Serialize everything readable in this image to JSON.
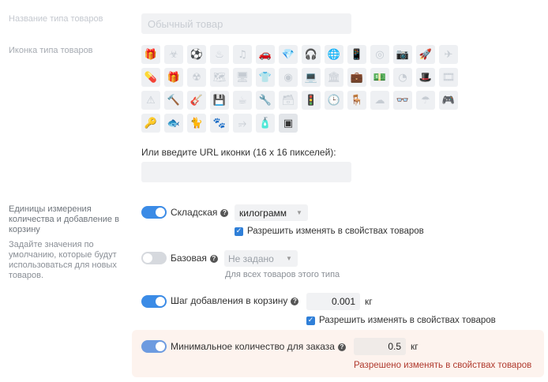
{
  "type_name": {
    "label": "Название типа товаров",
    "value": "Обычный товар"
  },
  "icon_section": {
    "label": "Иконка типа товаров",
    "rows": [
      [
        "gift-icon",
        "virus-icon",
        "soccer-ball-icon",
        "cake-icon",
        "music-note-icon",
        "car-icon",
        "diamond-icon",
        "headphones-icon",
        "globe-icon",
        "phone-icon",
        "target-icon",
        "camera-icon",
        "rocket-icon",
        "paper-plane-icon"
      ],
      [
        "pill-icon",
        "present-box-icon",
        "radiation-icon",
        "map-icon",
        "monitor-icon",
        "tshirt-icon",
        "tire-icon",
        "laptop-icon",
        "bank-icon",
        "briefcase-icon",
        "cash-icon",
        "pie-chart-icon",
        "top-hat-icon",
        "film-icon"
      ],
      [
        "warning-icon",
        "hammer-icon",
        "guitar-icon",
        "floppy-disk-icon",
        "coffee-cup-icon",
        "screwdriver-icon",
        "archive-box-icon",
        "traffic-light-icon",
        "clock-icon",
        "chair-icon",
        "cloud-download-icon",
        "glasses-icon",
        "umbrella-icon",
        "gamepad-icon"
      ],
      [
        "wrench-icon",
        "fish-icon",
        "cat-icon",
        "paw-icon",
        "usb-icon",
        "spray-bottle-icon",
        "package-box-icon"
      ]
    ],
    "glyphs": [
      [
        "🎁",
        "☣",
        "⚽",
        "♨",
        "♫",
        "🚗",
        "💎",
        "🎧",
        "🌐",
        "📱",
        "◎",
        "📷",
        "🚀",
        "✈"
      ],
      [
        "💊",
        "🎁",
        "☢",
        "🗺",
        "🖥",
        "👕",
        "◉",
        "💻",
        "🏛",
        "💼",
        "💵",
        "◔",
        "🎩",
        "🎞"
      ],
      [
        "⚠",
        "🔨",
        "🎸",
        "💾",
        "☕",
        "🔧",
        "🗃",
        "🚦",
        "🕒",
        "🪑",
        "☁",
        "👓",
        "☂",
        "🎮"
      ],
      [
        "🔑",
        "🐟",
        "🐈",
        "🐾",
        "⭌",
        "🧴",
        "▣"
      ]
    ],
    "selected_index": [
      3,
      6
    ]
  },
  "icon_url": {
    "label": "Или введите URL иконки (16 x 16 пикселей):",
    "value": ""
  },
  "units_section": {
    "title": "Единицы измерения количества и добавление в корзину",
    "description": "Задайте значения по умолчанию, которые будут использоваться для новых товаров."
  },
  "warehouse": {
    "label": "Складская",
    "enabled": true,
    "unit": "килограмм",
    "allow_label": "Разрешить изменять в свойствах товаров",
    "allow_checked": true
  },
  "base": {
    "label": "Базовая",
    "enabled": false,
    "unit": "Не задано",
    "hint": "Для всех товаров этого типа"
  },
  "step": {
    "label": "Шаг добавления в корзину",
    "enabled": true,
    "value": "0.001",
    "unit": "кг",
    "allow_label": "Разрешить изменять в свойствах товаров",
    "allow_checked": true
  },
  "min_qty": {
    "label": "Минимальное количество для заказа",
    "enabled": true,
    "value": "0.5",
    "unit": "кг",
    "note": "Разрешено изменять в свойствах товаров"
  },
  "colors": {
    "accent": "#3b8be6",
    "highlight_bg": "#fdf3ee",
    "note_text": "#c0392b"
  }
}
